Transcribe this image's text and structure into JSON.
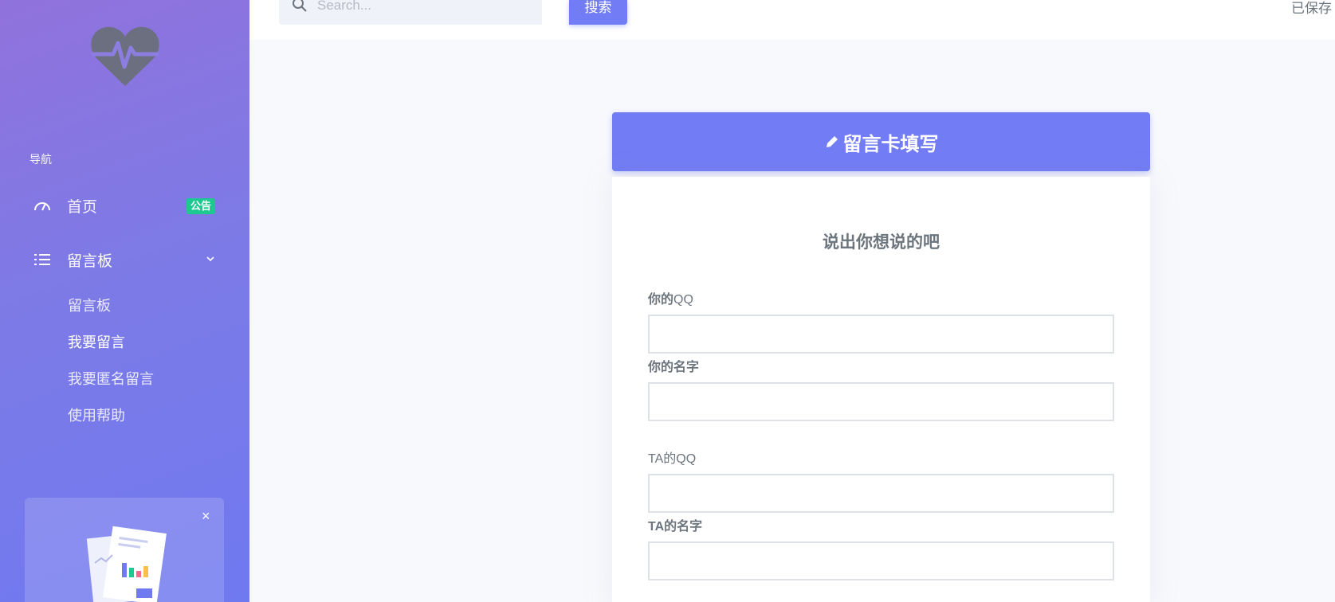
{
  "sidebar": {
    "nav_heading": "导航",
    "home": {
      "label": "首页",
      "badge": "公告",
      "badge_color": "#1dc98f"
    },
    "board": {
      "label": "留言板"
    },
    "sub_items": [
      {
        "label": "留言板"
      },
      {
        "label": "我要留言"
      },
      {
        "label": "我要匿名留言"
      },
      {
        "label": "使用帮助"
      }
    ],
    "promo_close": "×"
  },
  "topbar": {
    "search_placeholder": "Search...",
    "search_button": "搜索",
    "saved_text": "已保存"
  },
  "card": {
    "header_title": "留言卡填写",
    "form_heading": "说出你想说的吧",
    "fields": [
      {
        "label_bold": "你的",
        "label_rest": "QQ",
        "value": ""
      },
      {
        "label_bold": "你的名字",
        "label_rest": "",
        "value": ""
      },
      {
        "label_bold": "",
        "label_rest": "TA的QQ",
        "value": ""
      },
      {
        "label_bold": "TA的名字",
        "label_rest": "",
        "value": ""
      }
    ]
  },
  "colors": {
    "accent": "#727cf5",
    "badge": "#1dc98f",
    "sidebar_gradient_start": "#9172dc",
    "sidebar_gradient_end": "#6f79f0"
  },
  "icons": [
    "heart-pulse-logo",
    "speedometer-icon",
    "list-icon",
    "chevron-down-icon",
    "search-icon",
    "pencil-icon",
    "close-icon"
  ]
}
